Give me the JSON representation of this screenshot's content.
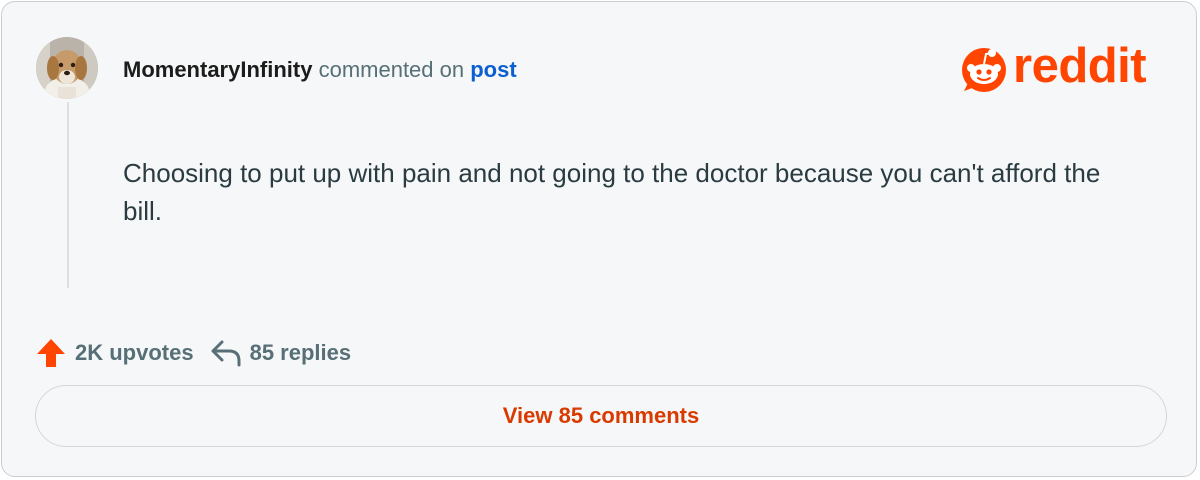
{
  "comment": {
    "username": "MomentaryInfinity",
    "action_text": " commented on ",
    "post_link_label": "post",
    "body": "Choosing to put up with pain and not going to the doctor because you can't afford the bill."
  },
  "brand": {
    "wordmark": "reddit",
    "color": "#ff4500",
    "icon": "reddit-snoo-icon"
  },
  "stats": {
    "upvotes_label": "2K upvotes",
    "replies_label": "85 replies",
    "upvote_icon": "upvote-arrow-icon",
    "reply_icon": "reply-arrow-icon"
  },
  "actions": {
    "view_comments_label": "View 85 comments"
  },
  "colors": {
    "accent_orange": "#ff4500",
    "link_blue": "#0b5fd0",
    "button_text": "#d93a00",
    "muted_text": "#576f76"
  }
}
